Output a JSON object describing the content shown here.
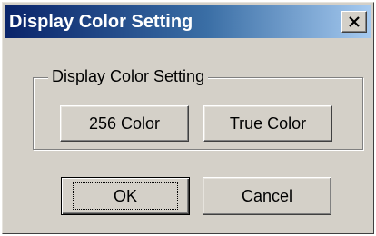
{
  "window": {
    "title": "Display Color Setting",
    "close_glyph": "×",
    "close_icon": "close-icon"
  },
  "group": {
    "legend": "Display Color Setting",
    "buttons": {
      "color256": "256 Color",
      "truecolor": "True Color"
    }
  },
  "actions": {
    "ok": "OK",
    "cancel": "Cancel"
  },
  "colors": {
    "titlebar_start": "#0a246a",
    "titlebar_end": "#a6caf0",
    "face": "#d4d0c8"
  }
}
